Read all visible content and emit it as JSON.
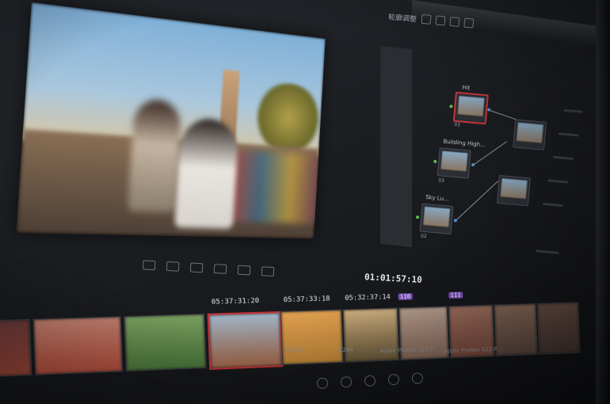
{
  "window": {
    "toolbar_label": "轮廓调整"
  },
  "viewer": {
    "timecode": "01:01:57:10"
  },
  "nodes": [
    {
      "id": "01",
      "title": "Hit",
      "selected": true
    },
    {
      "id": "03",
      "title": "Building High...",
      "selected": false
    },
    {
      "id": "02",
      "title": "Sky Lu...",
      "selected": false
    },
    {
      "id": "",
      "title": "",
      "selected": false
    },
    {
      "id": "",
      "title": "",
      "selected": false
    }
  ],
  "timeline": {
    "clips": [
      {
        "tc": "",
        "num": "",
        "selected": false,
        "color": "#a24a3a"
      },
      {
        "tc": "",
        "num": "",
        "selected": false,
        "color": "#b8503f"
      },
      {
        "tc": "",
        "num": "",
        "selected": false,
        "color": "#4d7a3c"
      },
      {
        "tc": "05:37:31:20",
        "num": "",
        "selected": true,
        "color": "#a86a4a"
      },
      {
        "tc": "05:37:33:18",
        "num": "",
        "selected": false,
        "color": "#c48a3a"
      },
      {
        "tc": "05:32:37:14",
        "num": "",
        "selected": false,
        "color": "#6b5a3a"
      },
      {
        "tc": "",
        "num": "110",
        "selected": false,
        "color": "#8a6a5a"
      },
      {
        "tc": "",
        "num": "111",
        "selected": false,
        "color": "#7b4a3e"
      },
      {
        "tc": "",
        "num": "",
        "selected": false,
        "color": "#5e4a40"
      }
    ],
    "codec_labels": [
      "H.264",
      "H.264",
      "Apple ProRes 422 P...",
      "Apple ProRes 422 P..."
    ]
  }
}
